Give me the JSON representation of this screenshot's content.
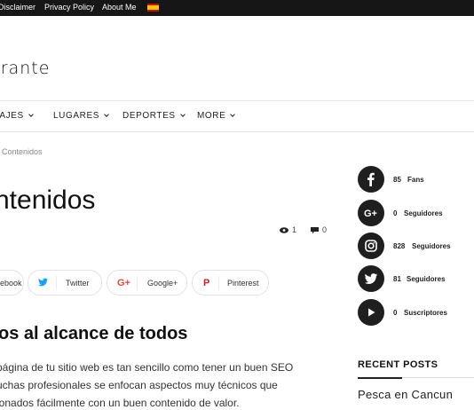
{
  "topbar": {
    "links": [
      "Disclaimer",
      "Privacy Policy",
      "About Me"
    ],
    "language_flag": "spain-flag-icon"
  },
  "site": {
    "logo_text": "rrante"
  },
  "nav": {
    "items": [
      "IAJES",
      "LUGARES",
      "DEPORTES",
      "MORE"
    ]
  },
  "breadcrumb": "Contenidos",
  "article": {
    "title": "ntenidos",
    "views": "1",
    "comments": "0",
    "share": {
      "facebook": "ebook",
      "twitter": "Twitter",
      "google": "Google+",
      "pinterest": "Pinterest"
    },
    "subheading": "os al alcance de todos",
    "paragraph": [
      "página de tu sitio web es tan sencillo como tener un buen SEO",
      "uchas profesionales se enfocan aspectos muy técnicos que",
      "ionados fácilmente con un buen contenido de valor."
    ]
  },
  "sidebar": {
    "social": [
      {
        "icon": "facebook-icon",
        "count": "85",
        "label": "Fans"
      },
      {
        "icon": "google-plus-icon",
        "count": "0",
        "label": "Seguidores"
      },
      {
        "icon": "instagram-icon",
        "count": "828",
        "label": "Seguidores"
      },
      {
        "icon": "twitter-icon",
        "count": "81",
        "label": "Seguidores"
      },
      {
        "icon": "youtube-icon",
        "count": "0",
        "label": "Suscriptores"
      }
    ],
    "recent_posts_title": "RECENT POSTS",
    "recent_posts": [
      "Pesca en Cancun"
    ]
  },
  "colors": {
    "topbar_bg": "#161616",
    "social_circle_bg": "#1f1f1f",
    "twitter_blue": "#1da1f2",
    "google_red": "#dd4b39",
    "pinterest_red": "#cb2027"
  }
}
